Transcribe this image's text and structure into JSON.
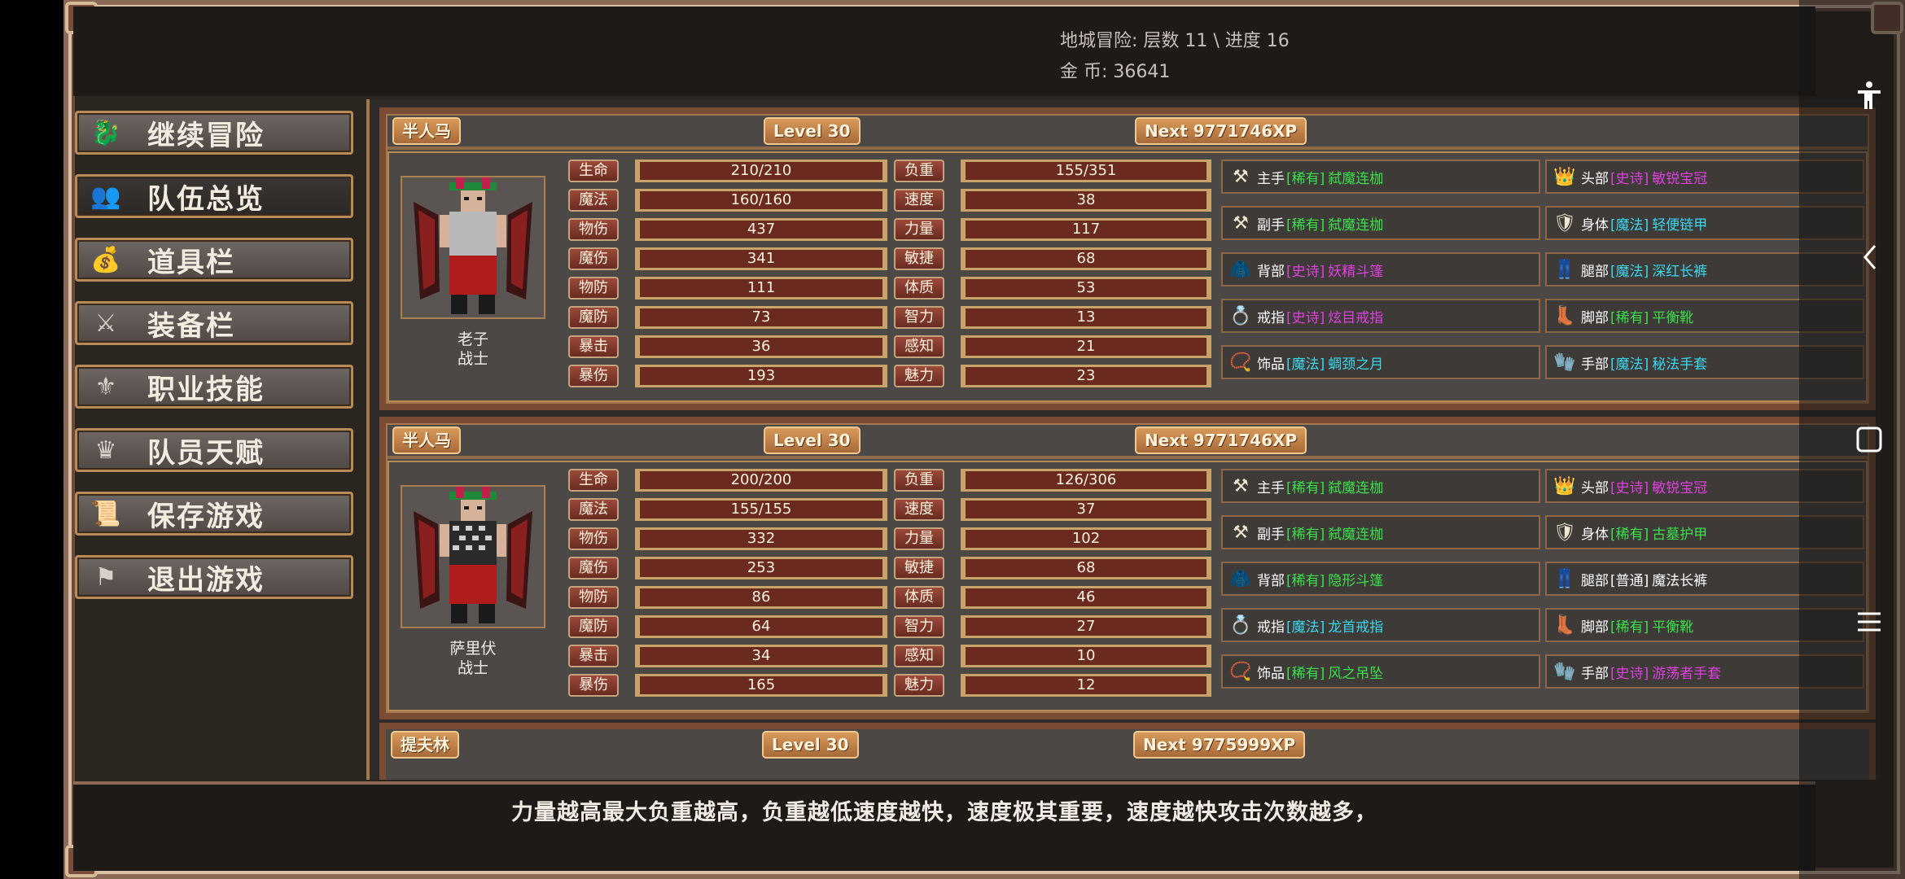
{
  "header": {
    "dungeon": "地城冒险: 层数 11 \\ 进度 16",
    "gold": "金      币: 36641"
  },
  "menu": [
    {
      "label": "继续冒险",
      "icon": "dragon-icon"
    },
    {
      "label": "队伍总览",
      "icon": "party-icon"
    },
    {
      "label": "道具栏",
      "icon": "bag-icon"
    },
    {
      "label": "装备栏",
      "icon": "sword-shield-icon"
    },
    {
      "label": "职业技能",
      "icon": "winged-sword-icon"
    },
    {
      "label": "队员天赋",
      "icon": "laurel-crown-icon"
    },
    {
      "label": "保存游戏",
      "icon": "scroll-icon"
    },
    {
      "label": "退出游戏",
      "icon": "flag-icon"
    }
  ],
  "characters": [
    {
      "race": "半人马",
      "level": "Level 30",
      "next": "Next 9771746XP",
      "name": "老子",
      "class": "战士",
      "stats_left": [
        {
          "label": "生命",
          "value": "210/210"
        },
        {
          "label": "魔法",
          "value": "160/160"
        },
        {
          "label": "物伤",
          "value": "437"
        },
        {
          "label": "魔伤",
          "value": "341"
        },
        {
          "label": "物防",
          "value": "111"
        },
        {
          "label": "魔防",
          "value": "73"
        },
        {
          "label": "暴击",
          "value": "36"
        },
        {
          "label": "暴伤",
          "value": "193"
        }
      ],
      "stats_right": [
        {
          "label": "负重",
          "value": "155/351"
        },
        {
          "label": "速度",
          "value": "38"
        },
        {
          "label": "力量",
          "value": "117"
        },
        {
          "label": "敏捷",
          "value": "68"
        },
        {
          "label": "体质",
          "value": "53"
        },
        {
          "label": "智力",
          "value": "13"
        },
        {
          "label": "感知",
          "value": "21"
        },
        {
          "label": "魅力",
          "value": "23"
        }
      ],
      "equip_left": [
        {
          "part": "主手",
          "rarity": "[稀有]",
          "name": "弑魔连枷",
          "rarity_color": "#39e04a",
          "icon": "flail-icon"
        },
        {
          "part": "副手",
          "rarity": "[稀有]",
          "name": "弑魔连枷",
          "rarity_color": "#39e04a",
          "icon": "flail-icon"
        },
        {
          "part": "背部",
          "rarity": "[史诗]",
          "name": "妖精斗篷",
          "rarity_color": "#e040e0",
          "icon": "cloak-icon"
        },
        {
          "part": "戒指",
          "rarity": "[史诗]",
          "name": "炫目戒指",
          "rarity_color": "#e040e0",
          "icon": "ring-icon"
        },
        {
          "part": "饰品",
          "rarity": "[魔法]",
          "name": "蜩颈之月",
          "rarity_color": "#38d8f0",
          "icon": "amulet-icon"
        }
      ],
      "equip_right": [
        {
          "part": "头部",
          "rarity": "[史诗]",
          "name": "敏锐宝冠",
          "rarity_color": "#e040e0",
          "icon": "crown-icon"
        },
        {
          "part": "身体",
          "rarity": "[魔法]",
          "name": "轻便链甲",
          "rarity_color": "#38d8f0",
          "icon": "armor-icon"
        },
        {
          "part": "腿部",
          "rarity": "[魔法]",
          "name": "深红长裤",
          "rarity_color": "#38d8f0",
          "icon": "pants-icon"
        },
        {
          "part": "脚部",
          "rarity": "[稀有]",
          "name": "平衡靴",
          "rarity_color": "#39e04a",
          "icon": "boots-icon"
        },
        {
          "part": "手部",
          "rarity": "[魔法]",
          "name": "秘法手套",
          "rarity_color": "#38d8f0",
          "icon": "gloves-icon"
        }
      ]
    },
    {
      "race": "半人马",
      "level": "Level 30",
      "next": "Next 9771746XP",
      "name": "萨里伏",
      "class": "战士",
      "stats_left": [
        {
          "label": "生命",
          "value": "200/200"
        },
        {
          "label": "魔法",
          "value": "155/155"
        },
        {
          "label": "物伤",
          "value": "332"
        },
        {
          "label": "魔伤",
          "value": "253"
        },
        {
          "label": "物防",
          "value": "86"
        },
        {
          "label": "魔防",
          "value": "64"
        },
        {
          "label": "暴击",
          "value": "34"
        },
        {
          "label": "暴伤",
          "value": "165"
        }
      ],
      "stats_right": [
        {
          "label": "负重",
          "value": "126/306"
        },
        {
          "label": "速度",
          "value": "37"
        },
        {
          "label": "力量",
          "value": "102"
        },
        {
          "label": "敏捷",
          "value": "68"
        },
        {
          "label": "体质",
          "value": "46"
        },
        {
          "label": "智力",
          "value": "27"
        },
        {
          "label": "感知",
          "value": "10"
        },
        {
          "label": "魅力",
          "value": "12"
        }
      ],
      "equip_left": [
        {
          "part": "主手",
          "rarity": "[稀有]",
          "name": "弑魔连枷",
          "rarity_color": "#39e04a",
          "icon": "flail-icon"
        },
        {
          "part": "副手",
          "rarity": "[稀有]",
          "name": "弑魔连枷",
          "rarity_color": "#39e04a",
          "icon": "flail-icon"
        },
        {
          "part": "背部",
          "rarity": "[稀有]",
          "name": "隐形斗篷",
          "rarity_color": "#39e04a",
          "icon": "cloak-icon"
        },
        {
          "part": "戒指",
          "rarity": "[魔法]",
          "name": "龙首戒指",
          "rarity_color": "#38d8f0",
          "icon": "ring-icon"
        },
        {
          "part": "饰品",
          "rarity": "[稀有]",
          "name": "风之吊坠",
          "rarity_color": "#39e04a",
          "icon": "amulet-icon"
        }
      ],
      "equip_right": [
        {
          "part": "头部",
          "rarity": "[史诗]",
          "name": "敏锐宝冠",
          "rarity_color": "#e040e0",
          "icon": "crown-icon"
        },
        {
          "part": "身体",
          "rarity": "[稀有]",
          "name": "古墓护甲",
          "rarity_color": "#39e04a",
          "icon": "armor-icon"
        },
        {
          "part": "腿部",
          "rarity": "[普通]",
          "name": "魔法长裤",
          "rarity_color": "#ffffff",
          "icon": "pants-icon"
        },
        {
          "part": "脚部",
          "rarity": "[稀有]",
          "name": "平衡靴",
          "rarity_color": "#39e04a",
          "icon": "boots-icon"
        },
        {
          "part": "手部",
          "rarity": "[史诗]",
          "name": "游荡者手套",
          "rarity_color": "#e040e0",
          "icon": "gloves-icon"
        }
      ]
    }
  ],
  "third_character": {
    "race": "提夫林",
    "level": "Level 30",
    "next": "Next 9775999XP"
  },
  "tip": "力量越高最大负重越高，负重越低速度越快，速度极其重要，速度越快攻击次数越多，"
}
